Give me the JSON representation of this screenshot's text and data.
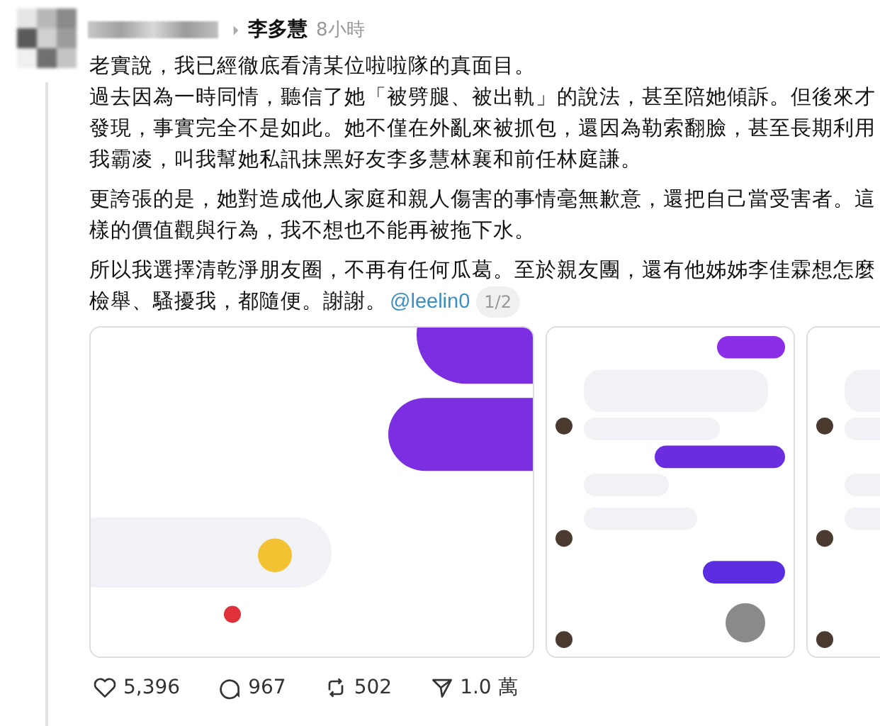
{
  "post": {
    "author": "李多慧",
    "time": "8小時",
    "lead": "老實說，我已經徹底看清某位啦啦隊的真面目。",
    "paragraphs": [
      "過去因為一時同情，聽信了她「被劈腿、被出軌」的說法，甚至陪她傾訴。但後來才發現，事實完全不是如此。她不僅在外亂來被抓包，還因為勒索翻臉，甚至長期利用我霸凌，叫我幫她私訊抹黑好友李多慧林襄和前任林庭謙。",
      "更誇張的是，她對造成他人家庭和親人傷害的事情毫無歉意，還把自己當受害者。這樣的價值觀與行為，我不想也不能再被拖下水。",
      "所以我選擇清乾淨朋友圈，不再有任何瓜葛。至於親友團，還有他姊姊李佳霖想怎麼檢舉、騷擾我，都隨便。謝謝。"
    ],
    "mention": "@leelin0",
    "page_badge": "1/2",
    "media": [
      {
        "kind": "picture"
      },
      {
        "kind": "picture"
      },
      {
        "kind": "picture"
      }
    ],
    "actions": [
      {
        "kind": "like",
        "count": "5,396"
      },
      {
        "kind": "comment",
        "count": "967"
      },
      {
        "kind": "repost",
        "count": "502"
      },
      {
        "kind": "share",
        "count": "1.0 萬"
      }
    ]
  }
}
